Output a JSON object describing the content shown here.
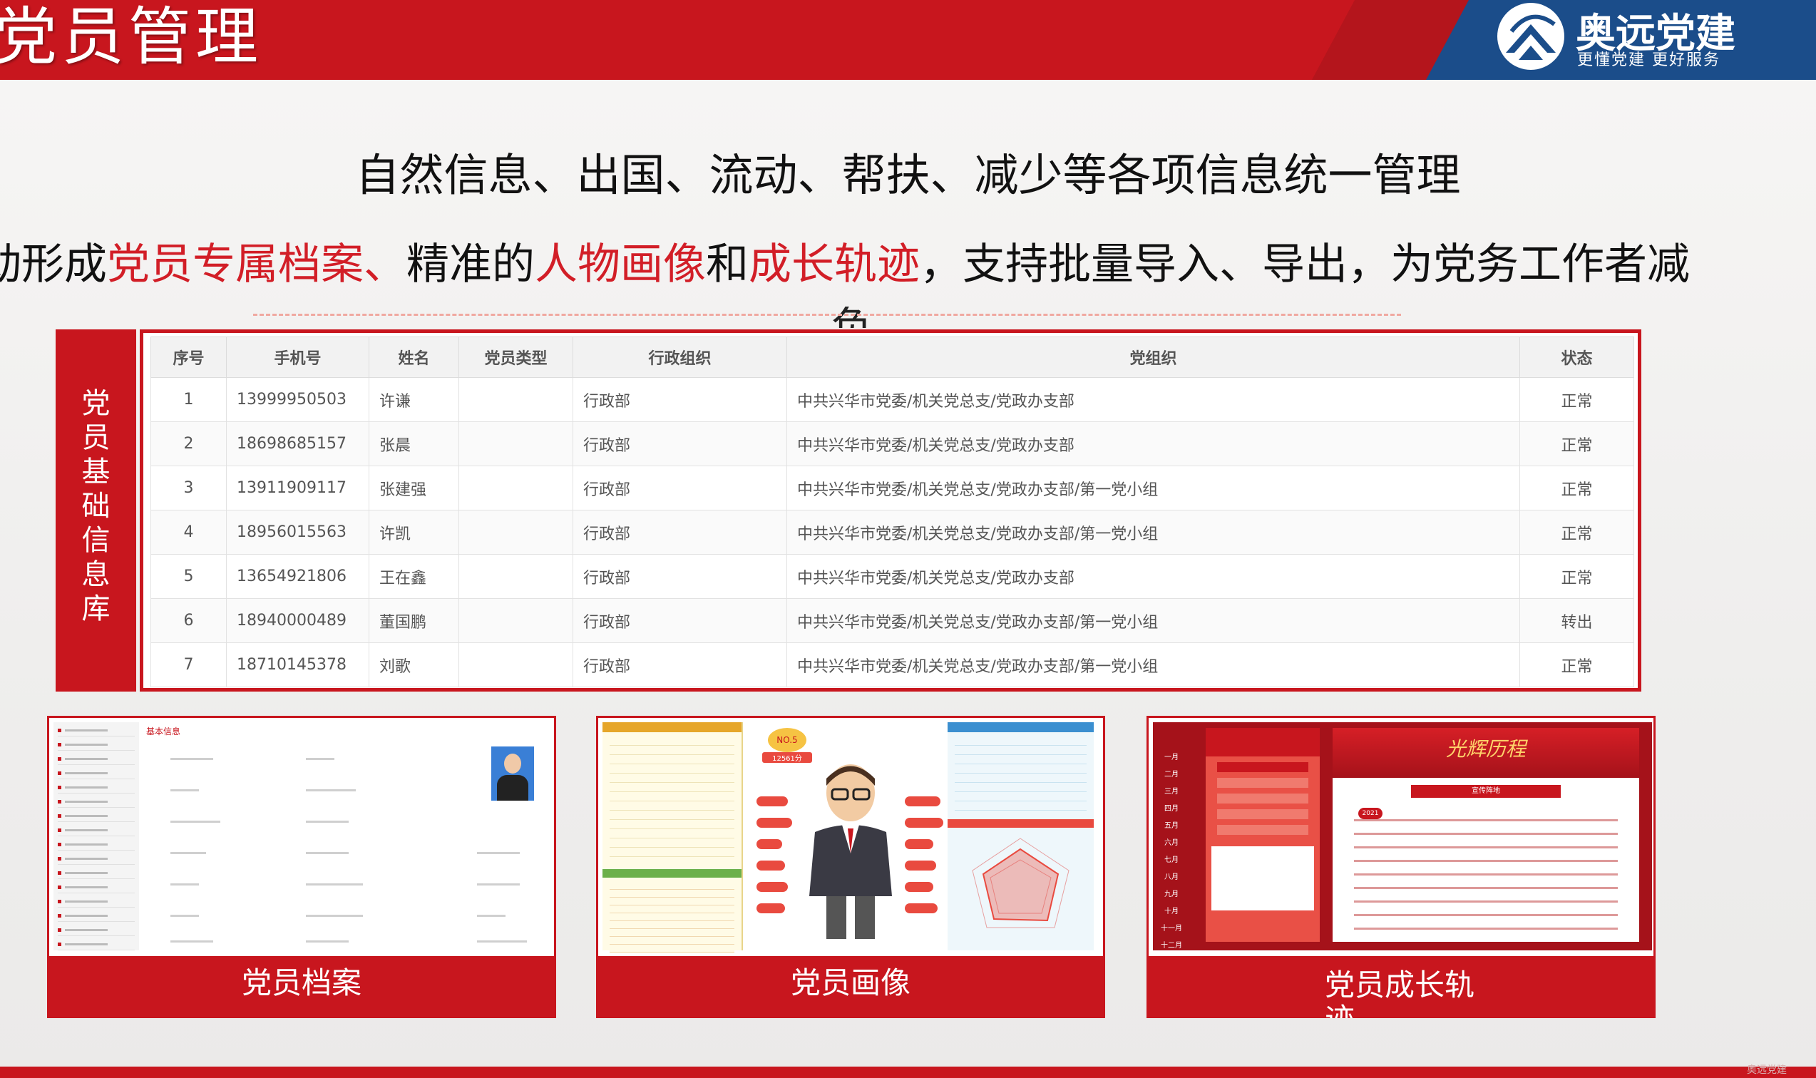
{
  "header": {
    "title": "党员管理",
    "logo_name": "奥远党建",
    "logo_slogan": "更懂党建 更好服务"
  },
  "headline": "自然信息、出国、流动、帮扶、减少等各项信息统一管理",
  "subline": {
    "part1": "动形成",
    "red1": "党员专属档案、",
    "part2": "精准的",
    "red2": "人物画像",
    "part3": "和",
    "red3": "成长轨迹",
    "part4": "，支持批量导入、导出，为党务工作者减",
    "overflow": "负"
  },
  "vertical_label": "党员基础信息库",
  "table": {
    "columns": [
      "序号",
      "手机号",
      "姓名",
      "党员类型",
      "行政组织",
      "党组织",
      "状态"
    ],
    "rows": [
      [
        "1",
        "13999950503",
        "许谦",
        "",
        "行政部",
        "中共兴华市党委/机关党总支/党政办支部",
        "正常"
      ],
      [
        "2",
        "18698685157",
        "张晨",
        "",
        "行政部",
        "中共兴华市党委/机关党总支/党政办支部",
        "正常"
      ],
      [
        "3",
        "13911909117",
        "张建强",
        "",
        "行政部",
        "中共兴华市党委/机关党总支/党政办支部/第一党小组",
        "正常"
      ],
      [
        "4",
        "18956015563",
        "许凯",
        "",
        "行政部",
        "中共兴华市党委/机关党总支/党政办支部/第一党小组",
        "正常"
      ],
      [
        "5",
        "13654921806",
        "王在鑫",
        "",
        "行政部",
        "中共兴华市党委/机关党总支/党政办支部",
        "正常"
      ],
      [
        "6",
        "18940000489",
        "董国鹏",
        "",
        "行政部",
        "中共兴华市党委/机关党总支/党政办支部/第一党小组",
        "转出"
      ],
      [
        "7",
        "18710145378",
        "刘歌",
        "",
        "行政部",
        "中共兴华市党委/机关党总支/党政办支部/第一党小组",
        "正常"
      ]
    ]
  },
  "cards": [
    {
      "caption": "党员档案",
      "section": "基本信息"
    },
    {
      "caption": "党员画像",
      "badge": "NO.5",
      "score": "12561分"
    },
    {
      "caption": "党员成长轨迹",
      "banner": "光辉历程",
      "year": "2021",
      "tag": "宣传阵地",
      "months": [
        "一月",
        "二月",
        "三月",
        "四月",
        "五月",
        "六月",
        "七月",
        "八月",
        "九月",
        "十月",
        "十一月",
        "十二月"
      ]
    }
  ],
  "colors": {
    "brand_red": "#c8161e",
    "accent_blue": "#1b4d8a",
    "highlight_red": "#d21e27"
  }
}
